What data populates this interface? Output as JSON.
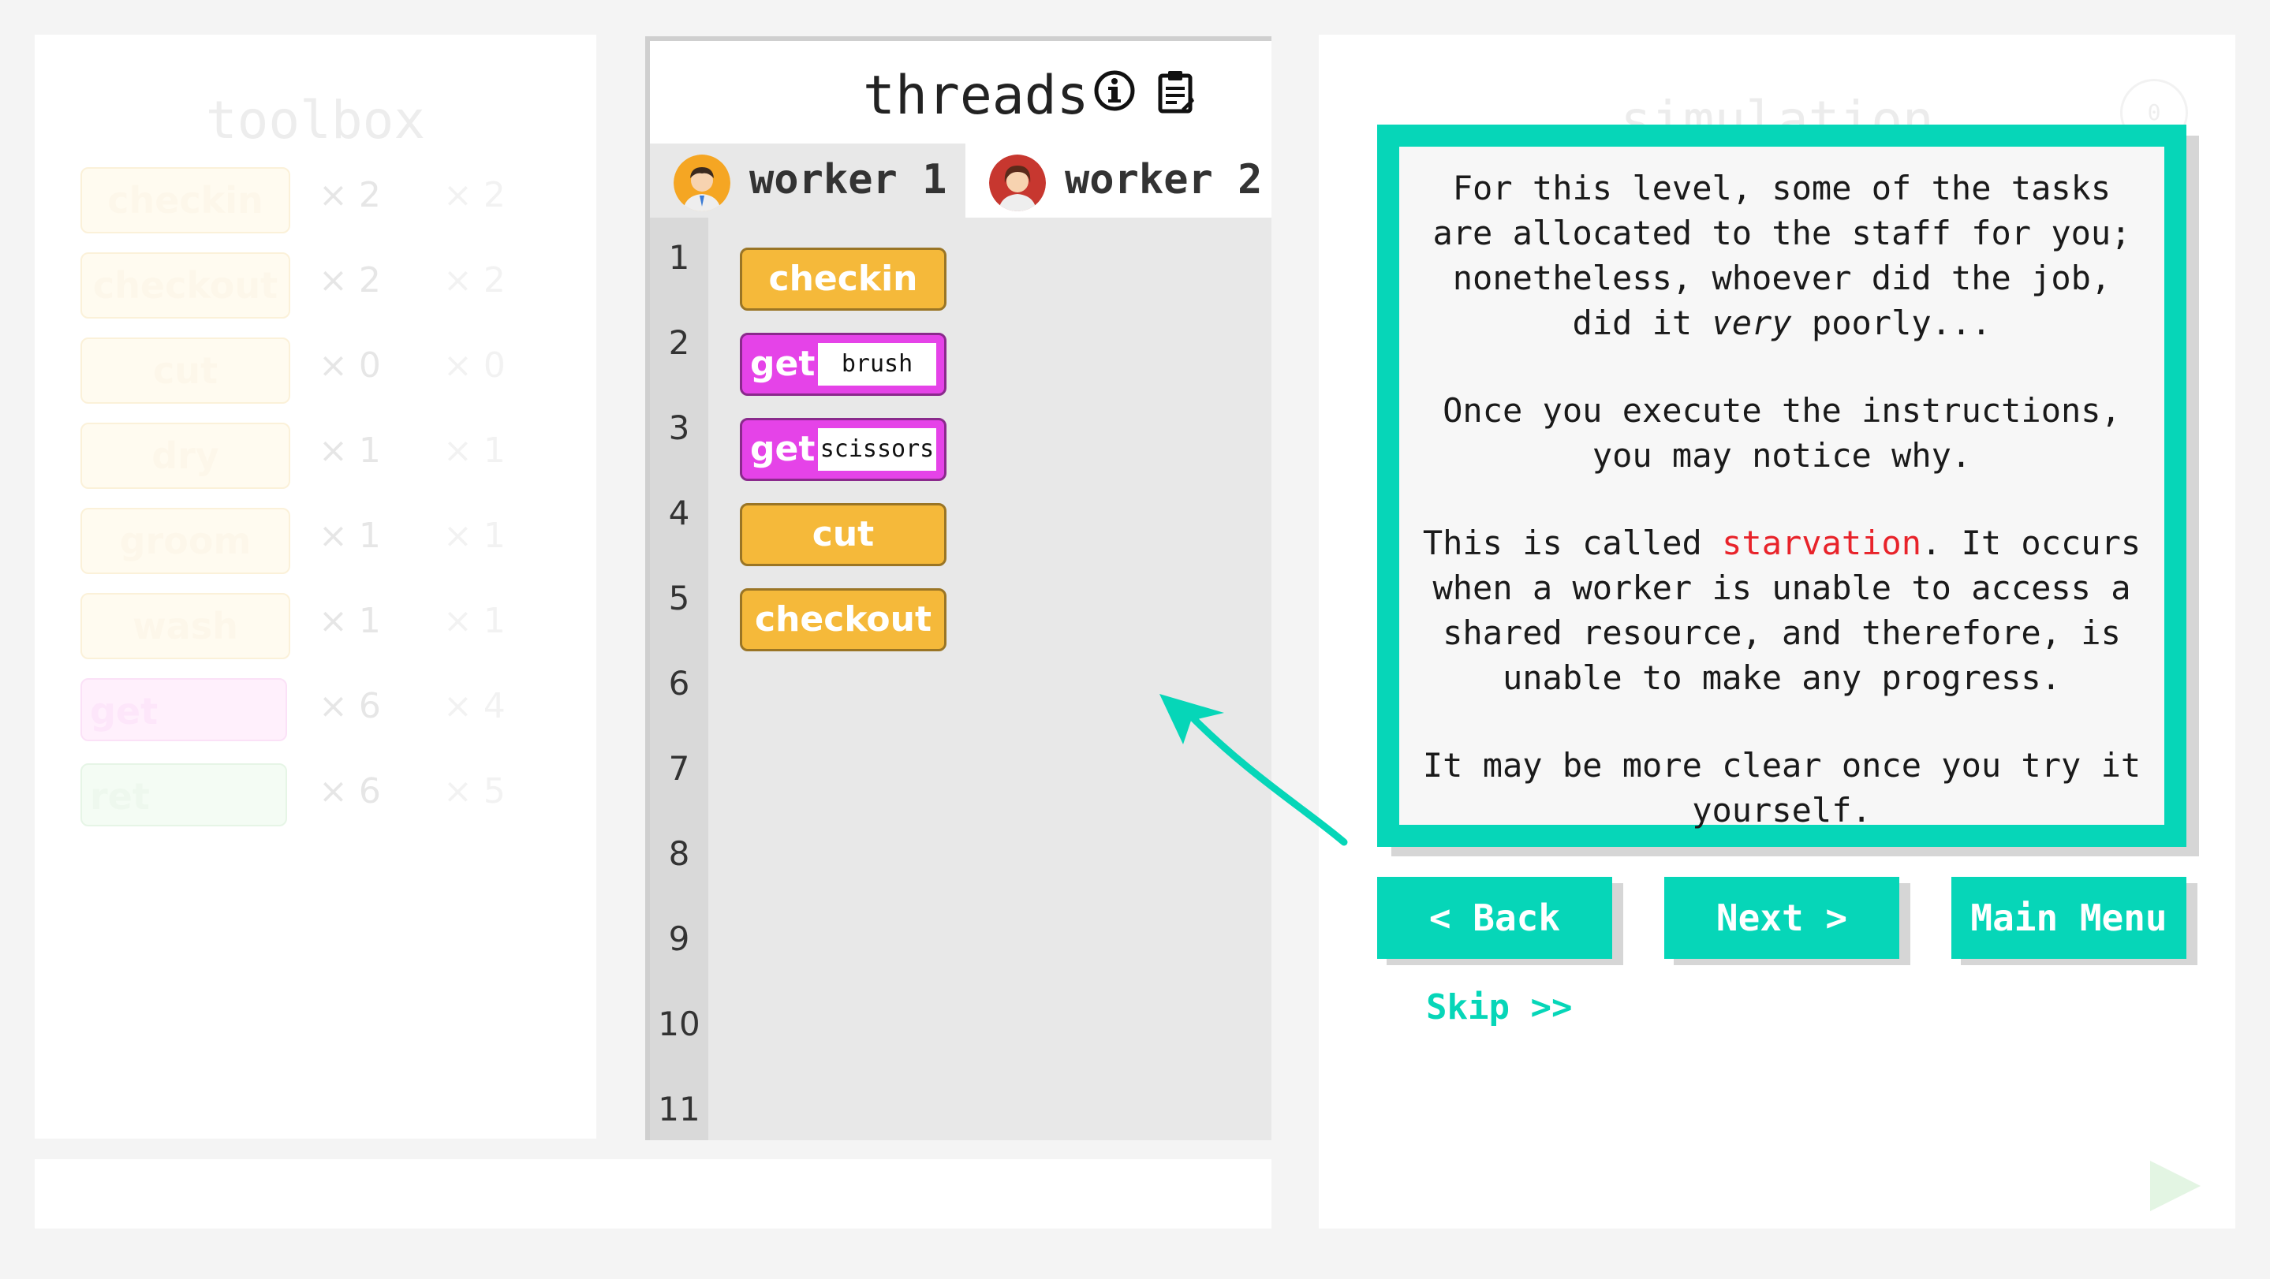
{
  "toolbox": {
    "title": "toolbox",
    "items": [
      {
        "label": "checkin",
        "count": "× 2",
        "count2": "× 2"
      },
      {
        "label": "checkout",
        "count": "× 2",
        "count2": "× 2"
      },
      {
        "label": "cut",
        "count": "× 0",
        "count2": "× 0"
      },
      {
        "label": "dry",
        "count": "× 1",
        "count2": "× 1"
      },
      {
        "label": "groom",
        "count": "× 1",
        "count2": "× 1"
      },
      {
        "label": "wash",
        "count": "× 1",
        "count2": "× 1"
      },
      {
        "label": "get",
        "count": "× 6",
        "count2": "× 4"
      },
      {
        "label": "ret",
        "count": "× 6",
        "count2": "× 5"
      }
    ]
  },
  "threads": {
    "title": "threads",
    "tabs": [
      {
        "label": "worker 1",
        "active": true
      },
      {
        "label": "worker 2",
        "active": false
      }
    ],
    "line_numbers": [
      "1",
      "2",
      "3",
      "4",
      "5",
      "6",
      "7",
      "8",
      "9",
      "10",
      "11"
    ],
    "blocks": [
      {
        "keyword": "checkin",
        "arg": null,
        "color": "yellow"
      },
      {
        "keyword": "get",
        "arg": "brush",
        "color": "magenta"
      },
      {
        "keyword": "get",
        "arg": "scissors",
        "color": "magenta"
      },
      {
        "keyword": "cut",
        "arg": null,
        "color": "yellow"
      },
      {
        "keyword": "checkout",
        "arg": null,
        "color": "yellow"
      }
    ]
  },
  "simulation": {
    "title": "simulation",
    "counter": "0"
  },
  "dialog": {
    "p1_a": "For this level, some of the tasks are allocated to the staff for you; nonetheless, whoever did the job, did it ",
    "p1_em": "very",
    "p1_b": " poorly...",
    "p2": "Once you execute the instructions, you may notice why.",
    "p3_a": "This is called ",
    "p3_hl": "starvation",
    "p3_b": ".  It occurs when a worker is unable to access a shared resource, and therefore, is unable to make any progress.",
    "p4": "It may be more clear once you try it yourself."
  },
  "buttons": {
    "back": "< Back",
    "next": "Next >",
    "main_menu": "Main Menu",
    "skip": "Skip >>"
  },
  "colors": {
    "accent": "#06d6b8",
    "block_yellow": "#f5b93a",
    "block_magenta": "#e543e8",
    "highlight_red": "#e8232a"
  }
}
